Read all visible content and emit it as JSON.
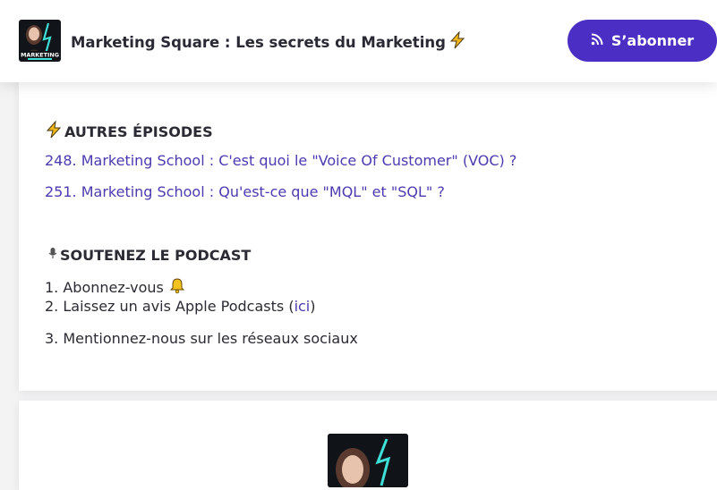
{
  "header": {
    "title": "Marketing Square : Les secrets du Marketing",
    "logo_text": "MARKETING",
    "subscribe_label": "S’abonner"
  },
  "episodes": {
    "heading": "AUTRES ÉPISODES",
    "items": [
      "248. Marketing School : C'est quoi le \"Voice Of Customer\" (VOC) ?",
      "251. Marketing School : Qu'est-ce que \"MQL\" et \"SQL\" ?"
    ]
  },
  "support": {
    "heading": "SOUTENEZ LE PODCAST",
    "item1": "1. Abonnez-vous",
    "item2_prefix": "2. Laissez un avis Apple Podcasts (",
    "item2_link": "ici",
    "item2_suffix": ")",
    "item3": "3. Mentionnez-nous sur les réseaux sociaux"
  },
  "colors": {
    "accent": "#4b2ec4",
    "link": "#4a3bb0",
    "bolt": "#f2b81c"
  },
  "icons": {
    "title_icon": "lightning-icon",
    "button_icon": "rss-icon",
    "episodes_icon": "lightning-icon",
    "support_icon": "microphone-icon",
    "bell": "bell-icon"
  }
}
